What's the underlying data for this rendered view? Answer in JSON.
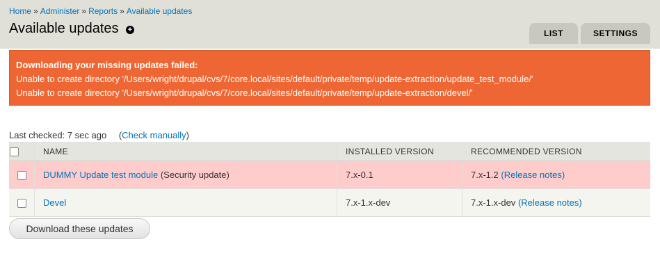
{
  "breadcrumb": {
    "items": [
      "Home",
      "Administer",
      "Reports",
      "Available updates"
    ],
    "separator": "»"
  },
  "page_title": "Available updates",
  "shortcut_icon": "plus-circle-icon",
  "tabs": [
    {
      "label": "LIST"
    },
    {
      "label": "SETTINGS"
    }
  ],
  "error": {
    "title": "Downloading your missing updates failed:",
    "lines": [
      "Unable to create directory '/Users/wright/drupal/cvs/7/core.local/sites/default/private/temp/update-extraction/update_test_module/'",
      "Unable to create directory '/Users/wright/drupal/cvs/7/core.local/sites/default/private/temp/update-extraction/devel/'"
    ],
    "color": "#ee6633"
  },
  "status": {
    "last_checked": "Last checked: 7 sec ago",
    "check_manually_open": "(",
    "check_manually_link": "Check manually",
    "check_manually_close": ")"
  },
  "table": {
    "headers": [
      "NAME",
      "INSTALLED VERSION",
      "RECOMMENDED VERSION"
    ],
    "rows": [
      {
        "name": "DUMMY Update test module",
        "tag": "(Security update)",
        "installed": "7.x-0.1",
        "recommended": "7.x-1.2",
        "notes": "(Release notes)",
        "highlight_color": "#ffcccc"
      },
      {
        "name": "Devel",
        "tag": "",
        "installed": "7.x-1.x-dev",
        "recommended": "7.x-1.x-dev",
        "notes": "(Release notes)",
        "highlight_color": "#f5f5f0"
      }
    ]
  },
  "download_button_label": "Download these updates",
  "link_color": "#0074bd"
}
